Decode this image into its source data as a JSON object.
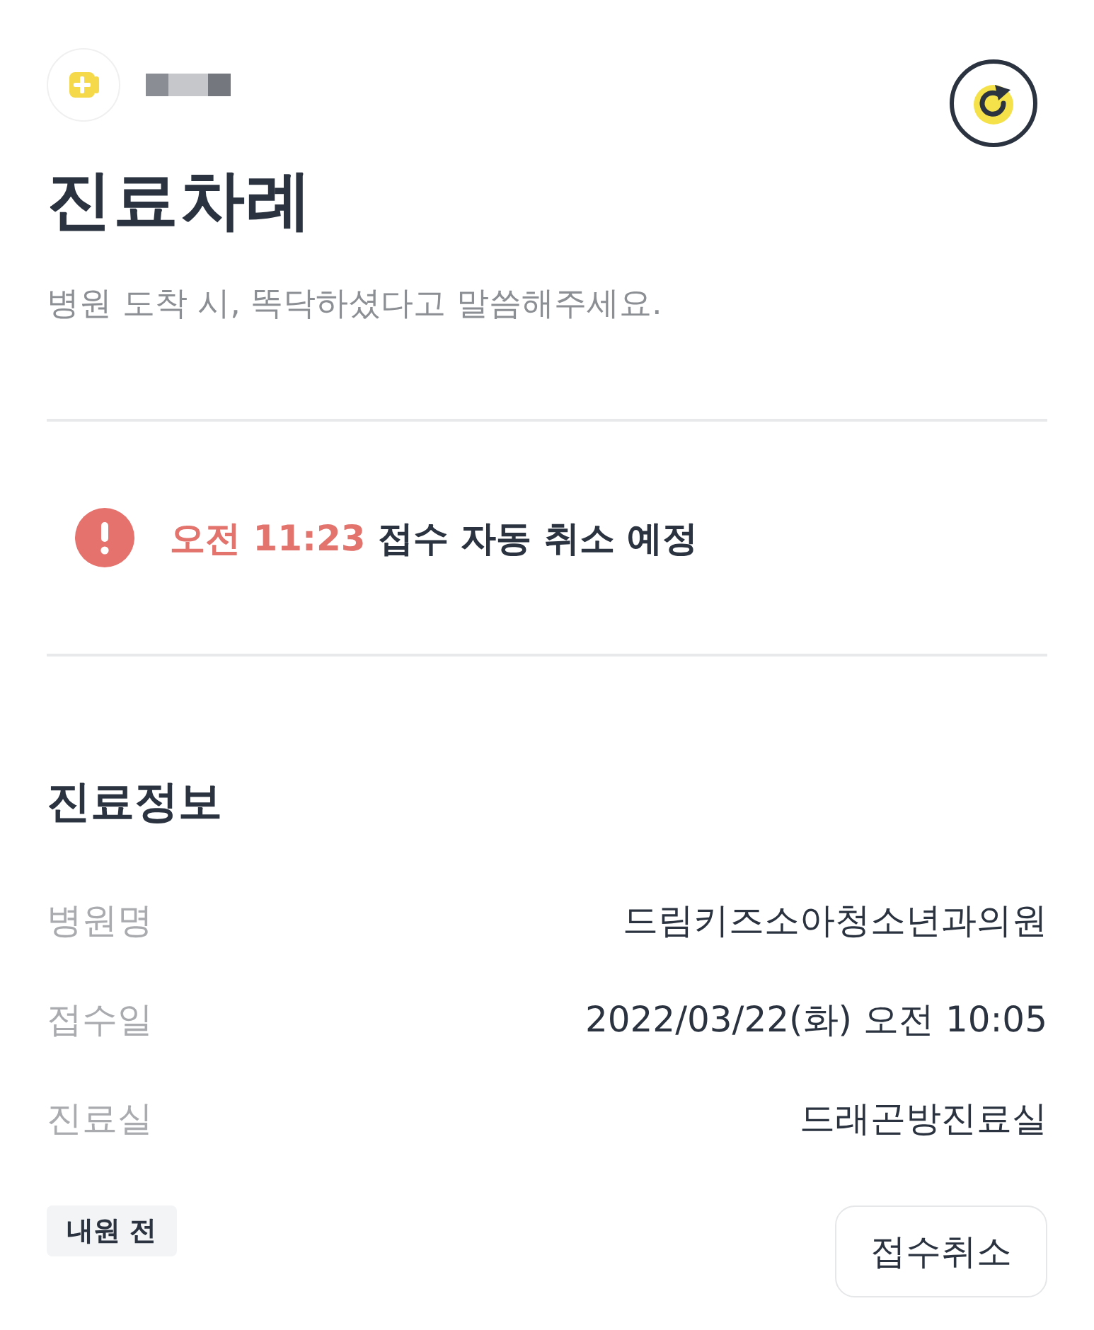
{
  "title": "진료차례",
  "subtitle": "병원 도착 시, 똑닥하셨다고 말씀해주세요.",
  "alert": {
    "time": "오전 11:23",
    "message": "접수 자동 취소 예정"
  },
  "info": {
    "title": "진료정보",
    "rows": [
      {
        "label": "병원명",
        "value": "드림키즈소아청소년과의원"
      },
      {
        "label": "접수일",
        "value": "2022/03/22(화) 오전 10:05"
      },
      {
        "label": "진료실",
        "value": "드래곤방진료실"
      }
    ]
  },
  "status_badge": "내원 전",
  "cancel_button": "접수취소"
}
